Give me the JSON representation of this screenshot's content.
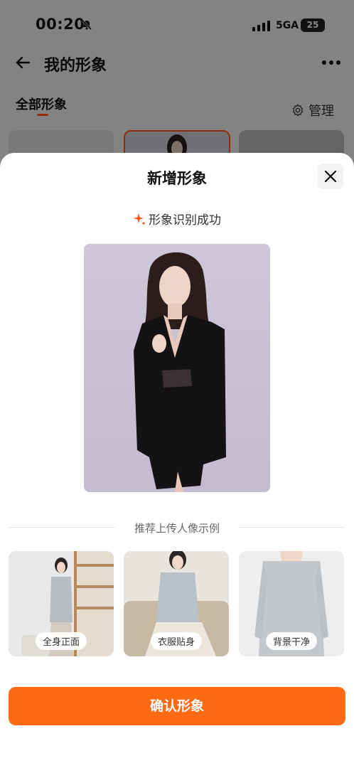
{
  "status_bar": {
    "time": "00:20",
    "network": "5GA",
    "battery": "25"
  },
  "nav": {
    "title": "我的形象"
  },
  "tabs": {
    "all_label": "全部形象",
    "manage_label": "管理"
  },
  "sheet": {
    "title": "新增形象",
    "success_text": "形象识别成功",
    "examples_heading": "推荐上传人像示例",
    "examples": [
      {
        "label": "全身正面"
      },
      {
        "label": "衣服贴身"
      },
      {
        "label": "背景干净"
      }
    ],
    "confirm_label": "确认形象"
  },
  "colors": {
    "accent": "#ff6a13",
    "tab_indicator": "#ff5a1f"
  },
  "icons": [
    "bell-muted-icon",
    "signal-icon",
    "back-arrow-icon",
    "more-icon",
    "gear-icon",
    "close-icon",
    "sparkle-icon"
  ]
}
